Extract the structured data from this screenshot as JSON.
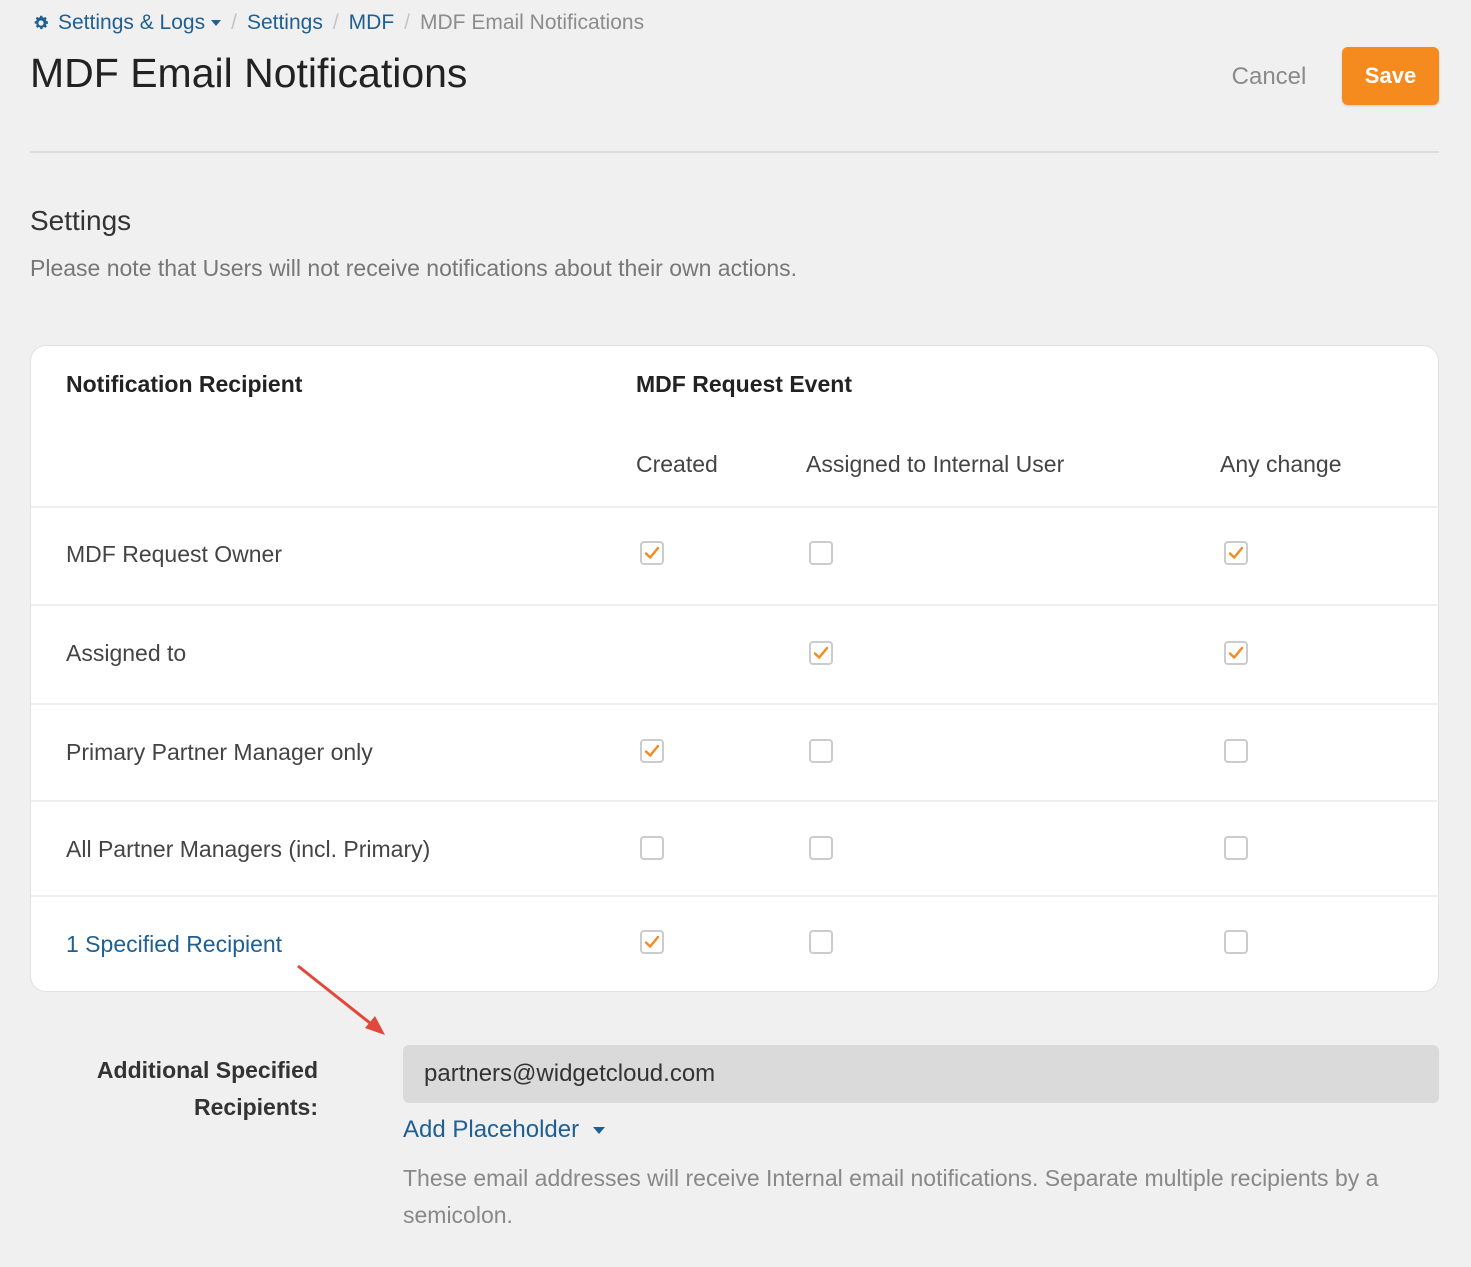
{
  "breadcrumb": {
    "root": "Settings & Logs",
    "items": [
      "Settings",
      "MDF"
    ],
    "current": "MDF Email Notifications",
    "separator": "/"
  },
  "page": {
    "title": "MDF Email Notifications"
  },
  "actions": {
    "cancel": "Cancel",
    "save": "Save"
  },
  "settings": {
    "title": "Settings",
    "note": "Please note that Users will not receive notifications about their own actions."
  },
  "table": {
    "recipient_header": "Notification Recipient",
    "event_header": "MDF Request Event",
    "columns": [
      "Created",
      "Assigned to Internal User",
      "Any change"
    ],
    "rows": [
      {
        "label": "MDF Request Owner",
        "checks": [
          true,
          false,
          true
        ]
      },
      {
        "label": "Assigned to",
        "checks": [
          null,
          true,
          true
        ]
      },
      {
        "label": "Primary Partner Manager only",
        "checks": [
          true,
          false,
          false
        ]
      },
      {
        "label": "All Partner Managers (incl. Primary)",
        "checks": [
          false,
          false,
          false
        ]
      },
      {
        "label": "1 Specified Recipient",
        "checks": [
          true,
          false,
          false
        ],
        "is_link": true
      }
    ]
  },
  "additional": {
    "label_line1": "Additional Specified",
    "label_line2": "Recipients:",
    "value": "partners@widgetcloud.com",
    "add_placeholder": "Add Placeholder",
    "help": "These email addresses will receive Internal email notifications. Separate multiple recipients by a semicolon."
  },
  "colors": {
    "accent": "#f58a1f",
    "link": "#1f5f92",
    "background": "#f0f0f0",
    "arrow": "#e0483a"
  }
}
